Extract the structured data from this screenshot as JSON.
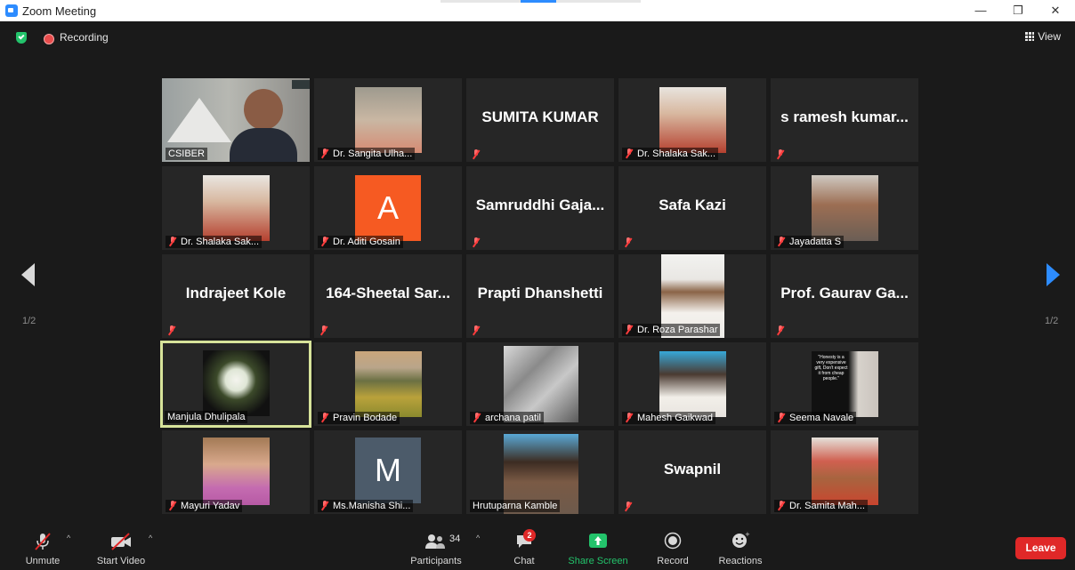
{
  "window": {
    "title": "Zoom Meeting"
  },
  "status": {
    "recording_label": "Recording",
    "view_label": "View"
  },
  "pagination": {
    "left": "1/2",
    "right": "1/2"
  },
  "tiles": [
    {
      "name": "CSIBER",
      "display": "video"
    },
    {
      "name": "Dr. Sangita Ulha...",
      "display": "photo"
    },
    {
      "name": "SUMITA KUMAR",
      "display": "name"
    },
    {
      "name": "Dr. Shalaka Sak...",
      "display": "photo"
    },
    {
      "name": "s ramesh kumar...",
      "display": "name"
    },
    {
      "name": "Dr. Shalaka Sak...",
      "display": "photo"
    },
    {
      "name": "Dr. Aditi Gosain",
      "display": "letter",
      "letter": "A"
    },
    {
      "name": "Samruddhi Gaja...",
      "display": "name"
    },
    {
      "name": "Safa Kazi",
      "display": "name"
    },
    {
      "name": "Jayadatta S",
      "display": "photo"
    },
    {
      "name": "Indrajeet Kole",
      "display": "name"
    },
    {
      "name": "164-Sheetal Sar...",
      "display": "name"
    },
    {
      "name": "Prapti Dhanshetti",
      "display": "name"
    },
    {
      "name": "Dr. Roza Parashar",
      "display": "video"
    },
    {
      "name": "Prof. Gaurav Ga...",
      "display": "name"
    },
    {
      "name": "Manjula Dhulipala",
      "display": "photo"
    },
    {
      "name": "Pravin Bodade",
      "display": "photo"
    },
    {
      "name": "archana patil",
      "display": "photo"
    },
    {
      "name": "Mahesh Gaikwad",
      "display": "photo"
    },
    {
      "name": "Seema Navale",
      "display": "photo",
      "quote": "\"Honesty is a very expensive gift, Don't expect it from cheap people.\""
    },
    {
      "name": "Mayuri Yadav",
      "display": "photo"
    },
    {
      "name": "Ms.Manisha Shi...",
      "display": "letter",
      "letter": "M"
    },
    {
      "name": "Hrutuparna Kamble",
      "display": "photo"
    },
    {
      "name": "Swapnil",
      "display": "name"
    },
    {
      "name": "Dr. Samita Mah...",
      "display": "photo"
    }
  ],
  "toolbar": {
    "unmute": "Unmute",
    "start_video": "Start Video",
    "participants": "Participants",
    "participants_count": "34",
    "chat": "Chat",
    "chat_badge": "2",
    "share_screen": "Share Screen",
    "record": "Record",
    "reactions": "Reactions",
    "leave": "Leave"
  },
  "colors": {
    "accent": "#2d8cff",
    "leave": "#e02828",
    "share": "#23c36b",
    "active_speaker": "#d7e39a"
  }
}
